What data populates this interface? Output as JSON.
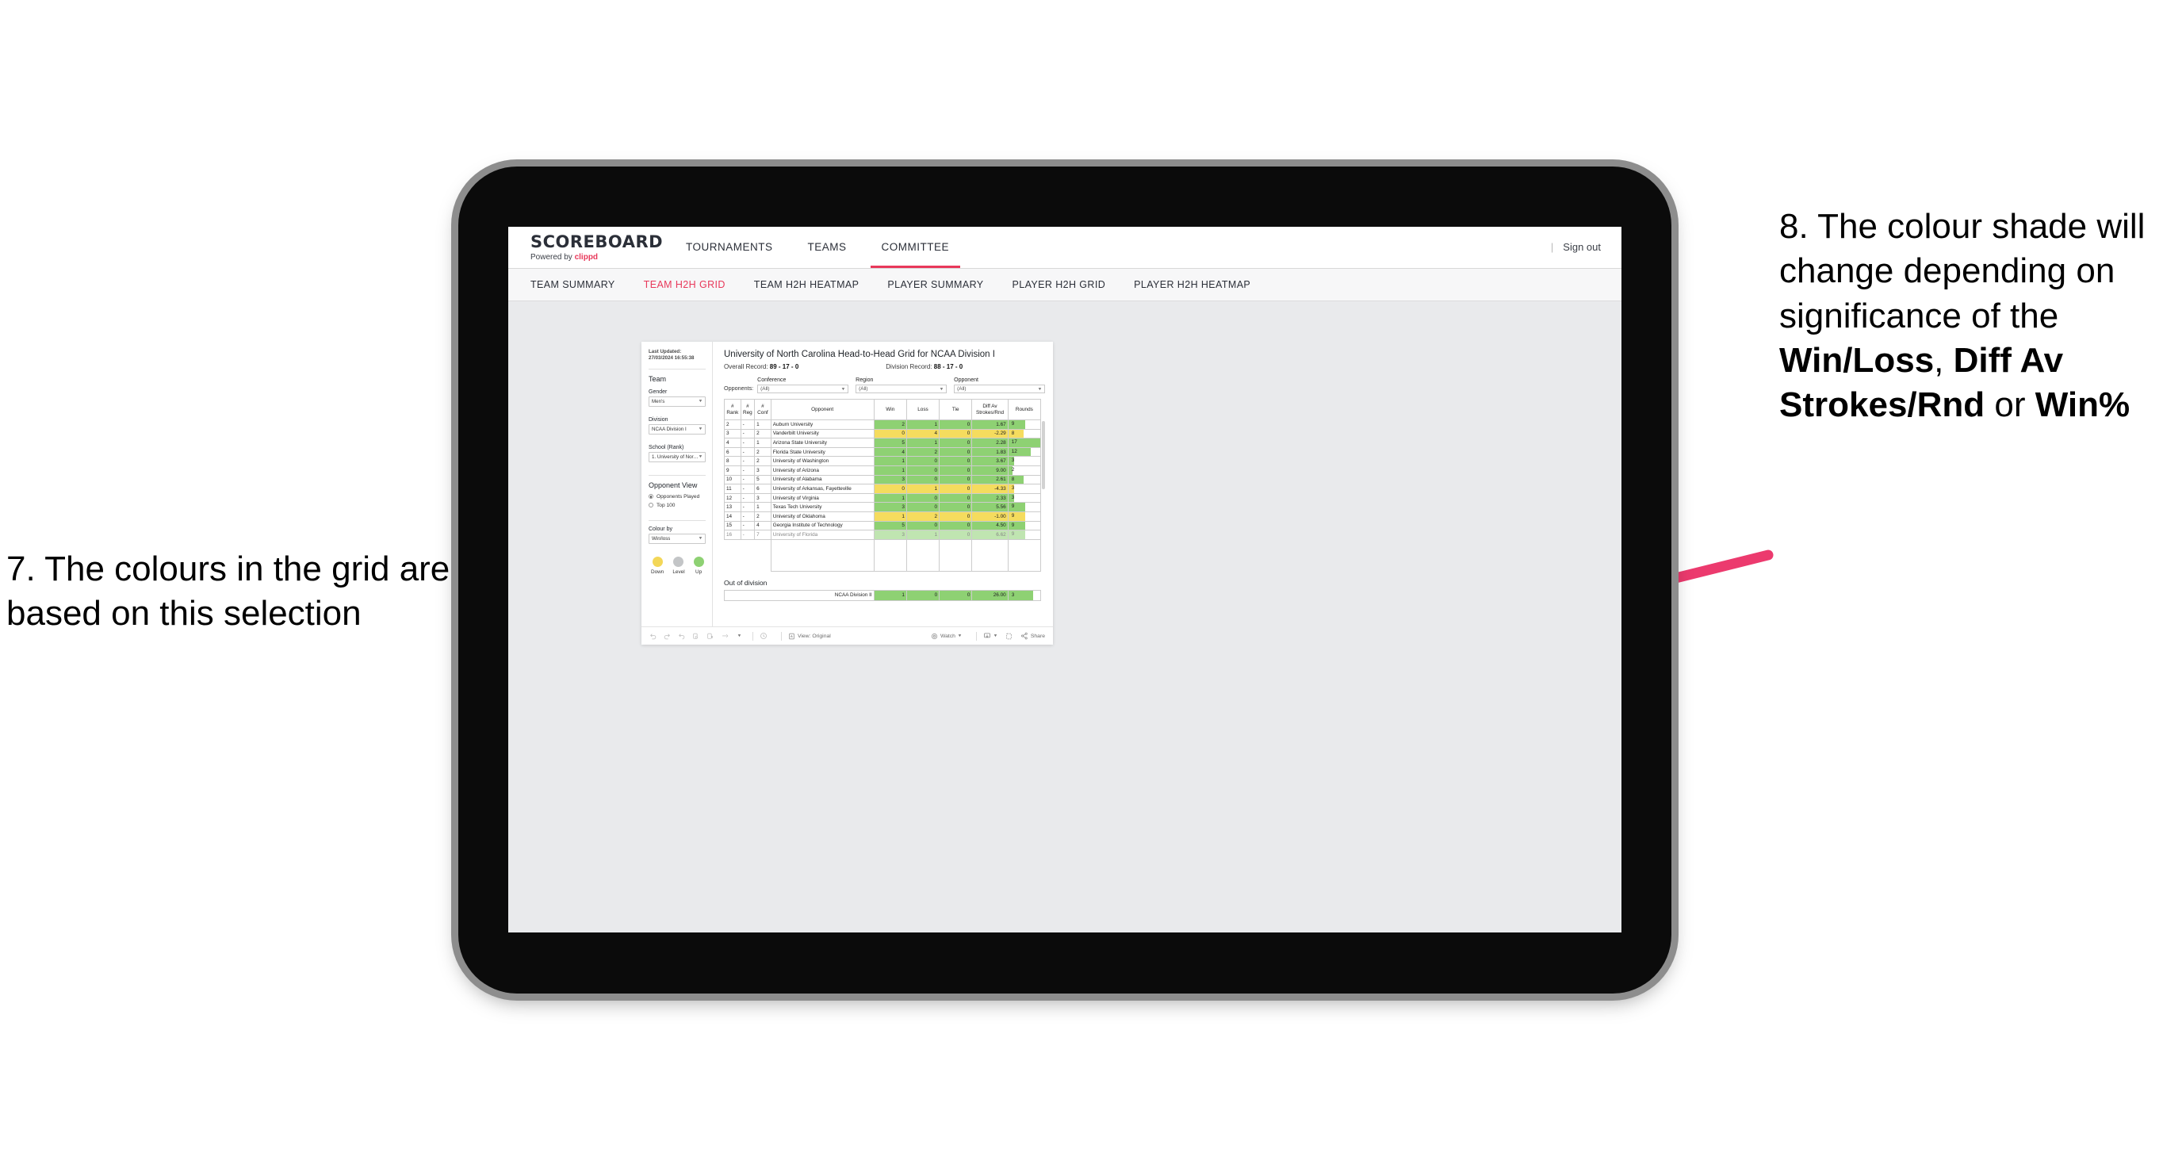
{
  "annotations": {
    "left": "7. The colours in the grid are based on this selection",
    "right_parts": [
      {
        "t": "8. The colour shade will change depending on significance of the ",
        "b": false
      },
      {
        "t": "Win/Loss",
        "b": true
      },
      {
        "t": ", ",
        "b": false
      },
      {
        "t": "Diff Av Strokes/Rnd",
        "b": true
      },
      {
        "t": " or ",
        "b": false
      },
      {
        "t": "Win%",
        "b": true
      }
    ],
    "arrow_color": "#ec3a6e"
  },
  "app": {
    "brand": {
      "logo": "SCOREBOARD",
      "powered_prefix": "Powered by ",
      "powered_name": "clippd"
    },
    "main_nav": [
      {
        "label": "TOURNAMENTS",
        "active": false
      },
      {
        "label": "TEAMS",
        "active": false
      },
      {
        "label": "COMMITTEE",
        "active": true
      }
    ],
    "sign_out": "Sign out",
    "sub_nav": [
      {
        "label": "TEAM SUMMARY",
        "active": false
      },
      {
        "label": "TEAM H2H GRID",
        "active": true
      },
      {
        "label": "TEAM H2H HEATMAP",
        "active": false
      },
      {
        "label": "PLAYER SUMMARY",
        "active": false
      },
      {
        "label": "PLAYER H2H GRID",
        "active": false
      },
      {
        "label": "PLAYER H2H HEATMAP",
        "active": false
      }
    ]
  },
  "sidebar": {
    "last_updated_label": "Last Updated:",
    "last_updated_value": " 27/03/2024 16:55:38",
    "team_heading": "Team",
    "gender_label": "Gender",
    "gender_value": "Men's",
    "division_label": "Division",
    "division_value": "NCAA Division I",
    "school_label": "School (Rank)",
    "school_value": "1. University of Nort...",
    "opponent_view_heading": "Opponent View",
    "opponent_view_options": [
      {
        "label": "Opponents Played",
        "selected": true
      },
      {
        "label": "Top 100",
        "selected": false
      }
    ],
    "colour_by_label": "Colour by",
    "colour_by_value": "Win/loss",
    "legend": [
      {
        "label": "Down",
        "color": "#f3d758"
      },
      {
        "label": "Level",
        "color": "#c3c5c7"
      },
      {
        "label": "Up",
        "color": "#8ed173"
      }
    ]
  },
  "viz": {
    "title": "University of North Carolina Head-to-Head Grid for NCAA Division I",
    "overall_record_label": "Overall Record:",
    "overall_record_value": " 89 - 17 - 0",
    "division_record_label": "Division Record:",
    "division_record_value": " 88 - 17 - 0",
    "opponents_label": "Opponents:",
    "filters": [
      {
        "name": "Conference",
        "value": "(All)"
      },
      {
        "name": "Region",
        "value": "(All)"
      },
      {
        "name": "Opponent",
        "value": "(All)"
      }
    ],
    "out_of_division_title": "Out of division"
  },
  "chart_data": {
    "type": "table",
    "title": "University of North Carolina Head-to-Head Grid for NCAA Division I",
    "columns": [
      "# Rank",
      "# Reg",
      "# Conf",
      "Opponent",
      "Win",
      "Loss",
      "Tie",
      "Diff Av Strokes/Rnd",
      "Rounds"
    ],
    "column_header_lines": [
      [
        "#",
        "Rank"
      ],
      [
        "#",
        "Reg"
      ],
      [
        "#",
        "Conf"
      ],
      [
        "Opponent"
      ],
      [
        "Win"
      ],
      [
        "Loss"
      ],
      [
        "Tie"
      ],
      [
        "Diff Av",
        "Strokes/Rnd"
      ],
      [
        "Rounds"
      ]
    ],
    "rounds_max": 17,
    "rows": [
      {
        "rank": "2",
        "reg": "-",
        "conf": "1",
        "opponent": "Auburn University",
        "win": "2",
        "loss": "1",
        "tie": "0",
        "diff": "1.67",
        "rounds": "9",
        "state": "up"
      },
      {
        "rank": "3",
        "reg": "-",
        "conf": "2",
        "opponent": "Vanderbilt University",
        "win": "0",
        "loss": "4",
        "tie": "0",
        "diff": "-2.29",
        "rounds": "8",
        "state": "down"
      },
      {
        "rank": "4",
        "reg": "-",
        "conf": "1",
        "opponent": "Arizona State University",
        "win": "5",
        "loss": "1",
        "tie": "0",
        "diff": "2.28",
        "rounds": "17",
        "state": "up"
      },
      {
        "rank": "6",
        "reg": "-",
        "conf": "2",
        "opponent": "Florida State University",
        "win": "4",
        "loss": "2",
        "tie": "0",
        "diff": "1.83",
        "rounds": "12",
        "state": "up"
      },
      {
        "rank": "8",
        "reg": "-",
        "conf": "2",
        "opponent": "University of Washington",
        "win": "1",
        "loss": "0",
        "tie": "0",
        "diff": "3.67",
        "rounds": "3",
        "state": "up"
      },
      {
        "rank": "9",
        "reg": "-",
        "conf": "3",
        "opponent": "University of Arizona",
        "win": "1",
        "loss": "0",
        "tie": "0",
        "diff": "9.00",
        "rounds": "2",
        "state": "up"
      },
      {
        "rank": "10",
        "reg": "-",
        "conf": "5",
        "opponent": "University of Alabama",
        "win": "3",
        "loss": "0",
        "tie": "0",
        "diff": "2.61",
        "rounds": "8",
        "state": "up"
      },
      {
        "rank": "11",
        "reg": "-",
        "conf": "6",
        "opponent": "University of Arkansas, Fayetteville",
        "win": "0",
        "loss": "1",
        "tie": "0",
        "diff": "-4.33",
        "rounds": "3",
        "state": "down"
      },
      {
        "rank": "12",
        "reg": "-",
        "conf": "3",
        "opponent": "University of Virginia",
        "win": "1",
        "loss": "0",
        "tie": "0",
        "diff": "2.33",
        "rounds": "3",
        "state": "up"
      },
      {
        "rank": "13",
        "reg": "-",
        "conf": "1",
        "opponent": "Texas Tech University",
        "win": "3",
        "loss": "0",
        "tie": "0",
        "diff": "5.56",
        "rounds": "9",
        "state": "up"
      },
      {
        "rank": "14",
        "reg": "-",
        "conf": "2",
        "opponent": "University of Oklahoma",
        "win": "1",
        "loss": "2",
        "tie": "0",
        "diff": "-1.00",
        "rounds": "9",
        "state": "down"
      },
      {
        "rank": "15",
        "reg": "-",
        "conf": "4",
        "opponent": "Georgia Institute of Technology",
        "win": "5",
        "loss": "0",
        "tie": "0",
        "diff": "4.50",
        "rounds": "9",
        "state": "up"
      },
      {
        "rank": "16",
        "reg": "-",
        "conf": "7",
        "opponent": "University of Florida",
        "win": "3",
        "loss": "1",
        "tie": "0",
        "diff": "6.62",
        "rounds": "9",
        "state": "up"
      }
    ],
    "out_of_division_rows": [
      {
        "label": "NCAA Division II",
        "win": "1",
        "loss": "0",
        "tie": "0",
        "diff": "26.00",
        "rounds": "3",
        "state": "up"
      }
    ],
    "colors": {
      "up": "#8ed173",
      "down": "#f5dc5e",
      "level": "#c3c5c7"
    }
  },
  "toolbar": {
    "view_label": "View: Original",
    "watch_label": "Watch",
    "share_label": "Share"
  }
}
